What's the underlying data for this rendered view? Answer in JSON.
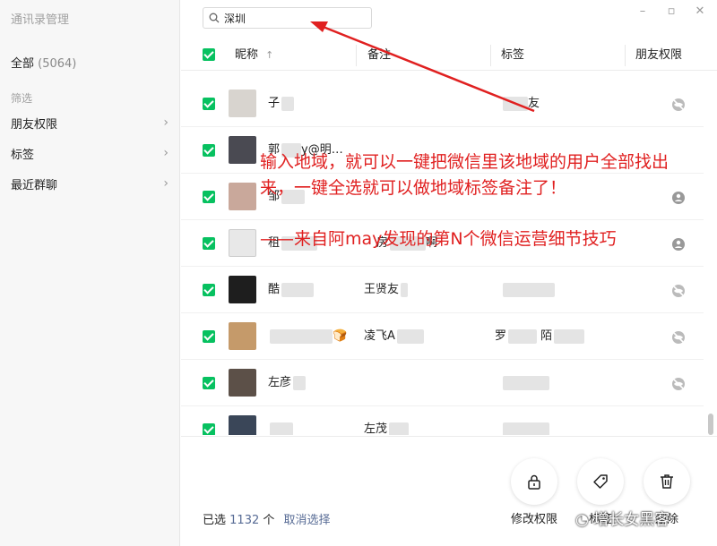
{
  "window": {
    "title": "通讯录管理"
  },
  "sidebar": {
    "all_label": "全部",
    "all_count": "(5064)",
    "filter_label": "筛选",
    "items": [
      {
        "label": "朋友权限"
      },
      {
        "label": "标签"
      },
      {
        "label": "最近群聊"
      }
    ]
  },
  "search": {
    "value": "深圳"
  },
  "table": {
    "columns": [
      "昵称",
      "备注",
      "标签",
      "朋友权限"
    ],
    "sort_indicator": "↑",
    "rows": [
      {
        "name": "子",
        "remark": "",
        "tag": "友",
        "privacy": "hidden"
      },
      {
        "name": "郭",
        "name_suffix": "y@明…",
        "remark": "",
        "tag": "",
        "privacy": "none"
      },
      {
        "name": "邹",
        "remark": "",
        "tag": "",
        "privacy": "contact"
      },
      {
        "name": "租",
        "remark": "房",
        "remark_suffix": "啊",
        "tag": "",
        "privacy": "contact"
      },
      {
        "name": "酷",
        "remark": "王贤友",
        "tag": "",
        "privacy": "hidden"
      },
      {
        "name": "",
        "name_suffix": "🍞",
        "remark": "凌飞A",
        "tag": "罗",
        "tag_suffix": "陌",
        "privacy": "hidden"
      },
      {
        "name": "左彦",
        "remark": "",
        "tag": "",
        "privacy": "hidden"
      },
      {
        "name": "",
        "remark": "左茂",
        "tag": "",
        "privacy": "none"
      }
    ]
  },
  "footer": {
    "selected_prefix": "已选",
    "selected_count": "1132",
    "selected_unit": "个",
    "cancel_label": "取消选择",
    "actions": [
      {
        "label": "修改权限",
        "icon": "lock-icon"
      },
      {
        "label": "标签",
        "icon": "tag-icon"
      },
      {
        "label": "删除",
        "icon": "trash-icon"
      }
    ]
  },
  "annotation": {
    "line1": "输入地域，就可以一键把微信里该地域的用户全部找出",
    "line2": "来，一键全选就可以做地域标签备注了！",
    "line3": "——来自阿may发现的第N个微信运营细节技巧",
    "color": "#e02020"
  },
  "watermark": "增长女黑客",
  "colors": {
    "accent": "#07c160",
    "link": "#576b95"
  }
}
